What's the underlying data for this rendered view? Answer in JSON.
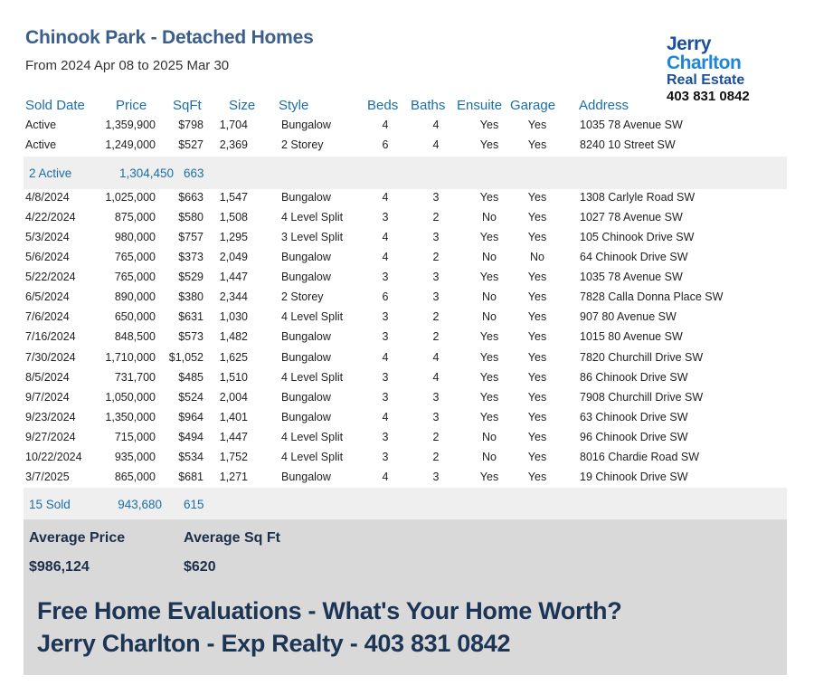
{
  "header": {
    "title": "Chinook Park -  Detached Homes",
    "subtitle": "From 2024 Apr 08 to 2025 Mar 30"
  },
  "logo": {
    "line1": "Jerry",
    "line2": "Charlton",
    "line3": "Real Estate",
    "phone": "403 831 0842"
  },
  "columns": {
    "sold_date": "Sold Date",
    "price": "Price",
    "sqft": "SqFt",
    "size": "Size",
    "style": "Style",
    "beds": "Beds",
    "baths": "Baths",
    "ensuite": "Ensuite",
    "garage": "Garage",
    "address": "Address"
  },
  "active_rows": [
    {
      "date": "Active",
      "price": "1,359,900",
      "sqft": "$798",
      "size": "1,704",
      "style": "Bungalow",
      "beds": "4",
      "baths": "4",
      "ensuite": "Yes",
      "garage": "Yes",
      "address": "1035 78 Avenue SW"
    },
    {
      "date": "Active",
      "price": "1,249,000",
      "sqft": "$527",
      "size": "2,369",
      "style": "2 Storey",
      "beds": "6",
      "baths": "4",
      "ensuite": "Yes",
      "garage": "Yes",
      "address": "8240 10 Street SW"
    }
  ],
  "active_summary": {
    "count": "2 Active",
    "price": "1,304,450",
    "sqft": "663"
  },
  "sold_rows": [
    {
      "date": "4/8/2024",
      "price": "1,025,000",
      "sqft": "$663",
      "size": "1,547",
      "style": "Bungalow",
      "beds": "4",
      "baths": "3",
      "ensuite": "Yes",
      "garage": "Yes",
      "address": "1308 Carlyle Road SW"
    },
    {
      "date": "4/22/2024",
      "price": "875,000",
      "sqft": "$580",
      "size": "1,508",
      "style": "4 Level Split",
      "beds": "3",
      "baths": "2",
      "ensuite": "No",
      "garage": "Yes",
      "address": "1027 78 Avenue SW"
    },
    {
      "date": "5/3/2024",
      "price": "980,000",
      "sqft": "$757",
      "size": "1,295",
      "style": "3 Level Split",
      "beds": "4",
      "baths": "3",
      "ensuite": "Yes",
      "garage": "Yes",
      "address": "105 Chinook Drive SW"
    },
    {
      "date": "5/6/2024",
      "price": "765,000",
      "sqft": "$373",
      "size": "2,049",
      "style": "Bungalow",
      "beds": "4",
      "baths": "2",
      "ensuite": "No",
      "garage": "No",
      "address": "64 Chinook Drive SW"
    },
    {
      "date": "5/22/2024",
      "price": "765,000",
      "sqft": "$529",
      "size": "1,447",
      "style": "Bungalow",
      "beds": "3",
      "baths": "3",
      "ensuite": "Yes",
      "garage": "Yes",
      "address": "1035 78 Avenue SW"
    },
    {
      "date": "6/5/2024",
      "price": "890,000",
      "sqft": "$380",
      "size": "2,344",
      "style": "2 Storey",
      "beds": "6",
      "baths": "3",
      "ensuite": "No",
      "garage": "Yes",
      "address": "7828 Calla Donna Place SW"
    },
    {
      "date": "7/6/2024",
      "price": "650,000",
      "sqft": "$631",
      "size": "1,030",
      "style": "4 Level Split",
      "beds": "3",
      "baths": "2",
      "ensuite": "No",
      "garage": "Yes",
      "address": "907 80 Avenue SW"
    },
    {
      "date": "7/16/2024",
      "price": "848,500",
      "sqft": "$573",
      "size": "1,482",
      "style": "Bungalow",
      "beds": "3",
      "baths": "2",
      "ensuite": "Yes",
      "garage": "Yes",
      "address": "1015 80 Avenue SW"
    },
    {
      "date": "7/30/2024",
      "price": "1,710,000",
      "sqft": "$1,052",
      "size": "1,625",
      "style": "Bungalow",
      "beds": "4",
      "baths": "4",
      "ensuite": "Yes",
      "garage": "Yes",
      "address": "7820 Churchill Drive SW"
    },
    {
      "date": "8/5/2024",
      "price": "731,700",
      "sqft": "$485",
      "size": "1,510",
      "style": "4 Level Split",
      "beds": "3",
      "baths": "4",
      "ensuite": "Yes",
      "garage": "Yes",
      "address": "86 Chinook Drive SW"
    },
    {
      "date": "9/7/2024",
      "price": "1,050,000",
      "sqft": "$524",
      "size": "2,004",
      "style": "Bungalow",
      "beds": "3",
      "baths": "3",
      "ensuite": "Yes",
      "garage": "Yes",
      "address": "7908 Churchill Drive SW"
    },
    {
      "date": "9/23/2024",
      "price": "1,350,000",
      "sqft": "$964",
      "size": "1,401",
      "style": "Bungalow",
      "beds": "4",
      "baths": "3",
      "ensuite": "Yes",
      "garage": "Yes",
      "address": "63 Chinook Drive SW"
    },
    {
      "date": "9/27/2024",
      "price": "715,000",
      "sqft": "$494",
      "size": "1,447",
      "style": "4 Level Split",
      "beds": "3",
      "baths": "2",
      "ensuite": "No",
      "garage": "Yes",
      "address": "96 Chinook Drive SW"
    },
    {
      "date": "10/22/2024",
      "price": "935,000",
      "sqft": "$534",
      "size": "1,752",
      "style": "4 Level Split",
      "beds": "3",
      "baths": "2",
      "ensuite": "No",
      "garage": "Yes",
      "address": "8016 Chardie Road SW"
    },
    {
      "date": "3/7/2025",
      "price": "865,000",
      "sqft": "$681",
      "size": "1,271",
      "style": "Bungalow",
      "beds": "4",
      "baths": "3",
      "ensuite": "Yes",
      "garage": "Yes",
      "address": "19 Chinook Drive SW"
    }
  ],
  "sold_summary": {
    "count": "15 Sold",
    "price": "943,680",
    "sqft": "615"
  },
  "footer": {
    "avg_price_label": "Average Price",
    "avg_price_value": "$986,124",
    "avg_sqft_label": "Average Sq Ft",
    "avg_sqft_value": "$620",
    "cta_line1": "Free Home Evaluations - What's Your Home Worth?",
    "cta_line2": "Jerry Charlton - Exp Realty - 403 831 0842"
  }
}
